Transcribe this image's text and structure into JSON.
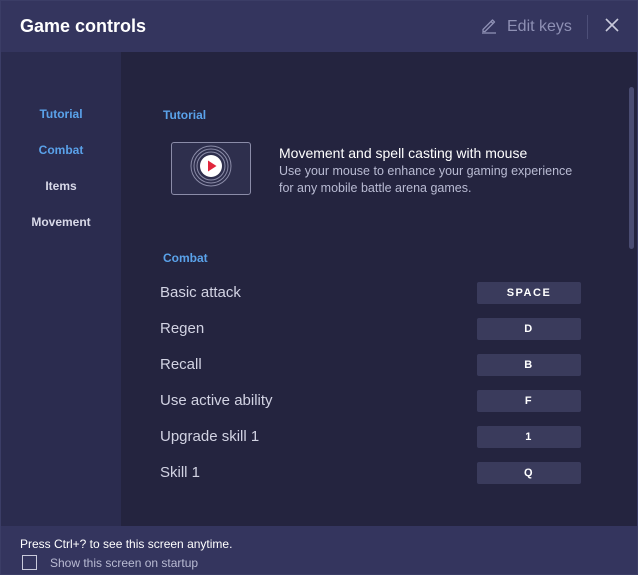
{
  "header": {
    "title": "Game controls",
    "edit_keys_label": "Edit keys",
    "edit_icon": "pencil-icon",
    "close_icon": "close-icon"
  },
  "sidebar": {
    "items": [
      {
        "label": "Tutorial",
        "active": true
      },
      {
        "label": "Combat",
        "active": true
      },
      {
        "label": "Items",
        "active": false
      },
      {
        "label": "Movement",
        "active": false
      }
    ]
  },
  "main": {
    "tutorial": {
      "section_label": "Tutorial",
      "video_icon": "play-icon",
      "title": "Movement and spell casting with mouse",
      "description": "Use your mouse to enhance your gaming experience for any mobile battle arena games."
    },
    "combat": {
      "section_label": "Combat",
      "controls": [
        {
          "label": "Basic attack",
          "key": "SPACE"
        },
        {
          "label": "Regen",
          "key": "D"
        },
        {
          "label": "Recall",
          "key": "B"
        },
        {
          "label": "Use active ability",
          "key": "F"
        },
        {
          "label": "Upgrade skill 1",
          "key": "1"
        },
        {
          "label": "Skill 1",
          "key": "Q"
        }
      ]
    }
  },
  "footer": {
    "hint": "Press Ctrl+? to see this screen anytime.",
    "checkbox_label": "Show this screen on startup",
    "checkbox_checked": false
  },
  "colors": {
    "accent": "#5aa2ea",
    "header_bg": "#34355e",
    "sidebar_bg": "#2b2c4f",
    "main_bg": "#24243f",
    "key_bg": "#3a3b5c",
    "play_red": "#e0263c"
  }
}
